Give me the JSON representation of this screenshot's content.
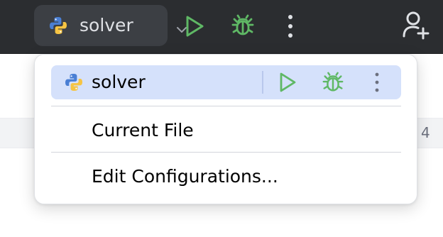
{
  "toolbar": {
    "run_config_name": "solver",
    "icons": {
      "config_type": "python-icon",
      "dropdown": "chevron-down-icon",
      "run": "run-icon",
      "debug": "debug-icon",
      "more": "more-vertical-icon",
      "add_user": "add-user-icon"
    }
  },
  "page": {
    "side_value": "4"
  },
  "popup": {
    "selected_item": {
      "label": "solver",
      "icons": [
        "python-icon",
        "run-icon",
        "debug-icon",
        "more-vertical-icon"
      ]
    },
    "items": [
      {
        "label": "Current File"
      },
      {
        "label": "Edit Configurations..."
      }
    ]
  },
  "colors": {
    "toolbar_bg": "#2b2d30",
    "widget_bg": "#3c3f44",
    "run_green": "#5fb865",
    "selection_bg": "#d5e1fb",
    "python_blue": "#4a7fd4",
    "python_yellow": "#f6c443"
  }
}
